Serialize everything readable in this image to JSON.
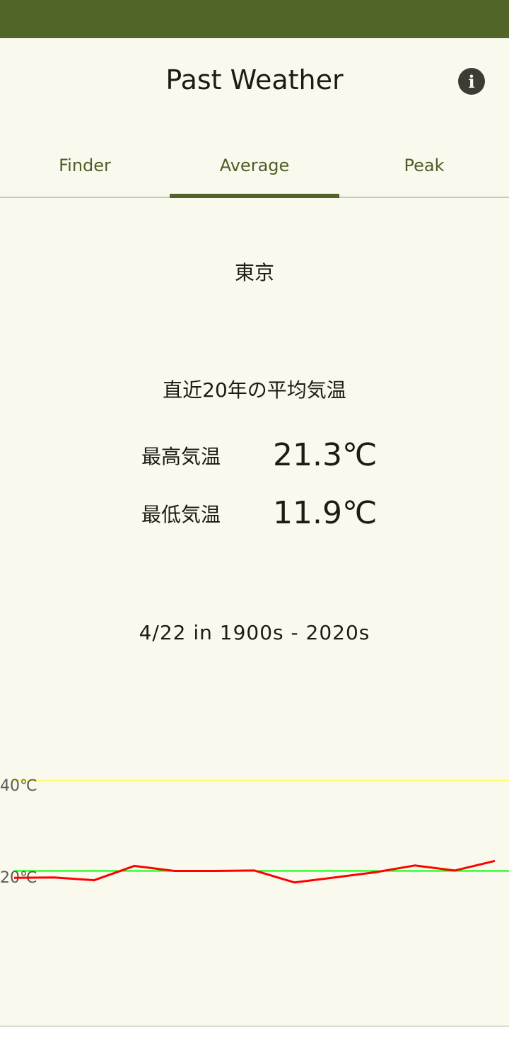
{
  "app": {
    "title": "Past Weather"
  },
  "tabs": [
    {
      "label": "Finder"
    },
    {
      "label": "Average",
      "active": true
    },
    {
      "label": "Peak"
    }
  ],
  "location": "東京",
  "summary": {
    "heading": "直近20年の平均気温",
    "high": {
      "label": "最高気温",
      "value": "21.3℃"
    },
    "low": {
      "label": "最低気温",
      "value": "11.9℃"
    }
  },
  "range": "4/22 in 1900s - 2020s",
  "colors": {
    "brand": "#526529",
    "background": "#f9f9ed",
    "series": "#ff0000",
    "refLine40": "#ffff66",
    "refLine20": "#00ff00"
  },
  "icons": {
    "info": "info-icon"
  },
  "chart_data": {
    "type": "line",
    "ylim": [
      0,
      45
    ],
    "yticks": [
      {
        "value": 40,
        "label": "40℃"
      },
      {
        "value": 20,
        "label": "20℃"
      }
    ],
    "reference_lines": [
      {
        "value": 41,
        "color": "#ffff66"
      },
      {
        "value": 21.3,
        "color": "#00ff00"
      }
    ],
    "series": [
      {
        "color": "#ff0000",
        "values": [
          19.8,
          19.9,
          19.3,
          22.4,
          21.3,
          21.3,
          21.4,
          18.8,
          19.9,
          21.0,
          22.5,
          21.4,
          23.5
        ]
      }
    ],
    "grid": false,
    "legend": "none"
  }
}
